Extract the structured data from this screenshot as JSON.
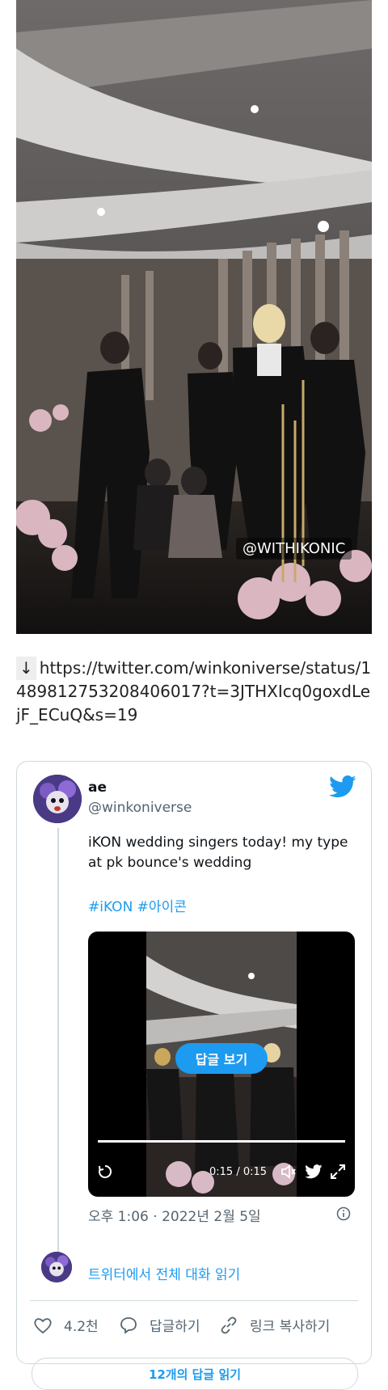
{
  "photo": {
    "watermark": "@WITHIKONIC"
  },
  "link": {
    "arrow": "↓",
    "url": "https://twitter.com/winkoniverse/status/1489812753208406017?t=3JTHXIcq0goxdLejF_ECuQ&s=19"
  },
  "tweet": {
    "name": "ae",
    "handle": "@winkoniverse",
    "text": "iKON wedding singers today! my type at pk bounce's wedding",
    "hashtags": "#iKON #아이콘",
    "video": {
      "reply_button": "답글 보기",
      "time": "0:15 / 0:15",
      "progress": 1.0
    },
    "timestamp": "오후 1:06 · 2022년 2월 5일",
    "read_conversation": "트위터에서 전체 대화 읽기",
    "actions": {
      "likes": "4.2천",
      "reply": "답글하기",
      "copy_link": "링크 복사하기"
    },
    "read_replies": "12개의 답글 읽기"
  },
  "colors": {
    "accent": "#1d9bf0",
    "muted": "#536471",
    "border": "#cfd9de"
  },
  "icons": [
    "twitter-bird-icon",
    "info-icon",
    "heart-icon",
    "reply-icon",
    "link-icon",
    "replay-icon",
    "volume-icon",
    "fullscreen-icon"
  ]
}
